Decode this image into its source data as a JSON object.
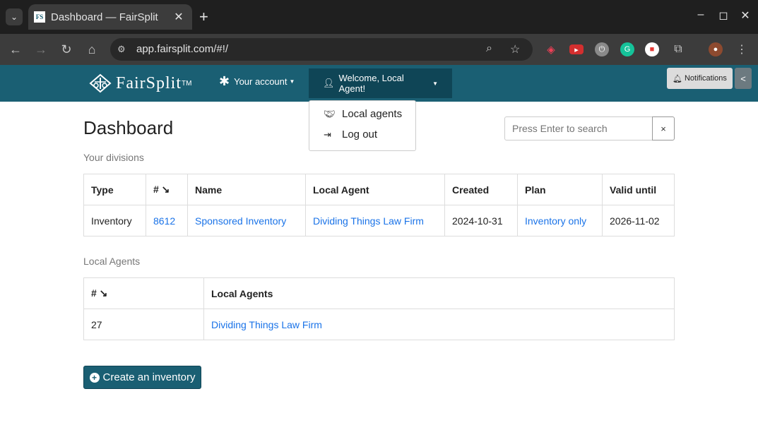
{
  "browser": {
    "tab_title": "Dashboard — FairSplit",
    "favicon_text": "FS",
    "url": "app.fairsplit.com/#!/"
  },
  "nav": {
    "brand": "FairSplit",
    "brand_tm": "TM",
    "account_label": "Your account",
    "welcome_label": "Welcome, Local Agent!",
    "notifications_label": "Notifications",
    "toggle_label": "<"
  },
  "dropdown": {
    "items": [
      {
        "label": "Local agents",
        "icon": "handshake-icon"
      },
      {
        "label": "Log out",
        "icon": "sign-out-icon"
      }
    ]
  },
  "main": {
    "title": "Dashboard",
    "search_placeholder": "Press Enter to search",
    "search_clear": "×",
    "divisions_label": "Your divisions",
    "divisions": {
      "headers": [
        "Type",
        "# ↘",
        "Name",
        "Local Agent",
        "Created",
        "Plan",
        "Valid until"
      ],
      "rows": [
        [
          "Inventory",
          "8612",
          "Sponsored Inventory",
          "Dividing Things Law Firm",
          "2024-10-31",
          "Inventory only",
          "2026-11-02"
        ]
      ]
    },
    "agents_label": "Local Agents",
    "agents": {
      "headers": [
        "# ↘",
        "Local Agents"
      ],
      "rows": [
        [
          "27",
          "Dividing Things Law Firm"
        ]
      ]
    },
    "create_button": "Create an inventory"
  },
  "colors": {
    "brand": "#1a5f73",
    "link": "#1a73e8"
  }
}
